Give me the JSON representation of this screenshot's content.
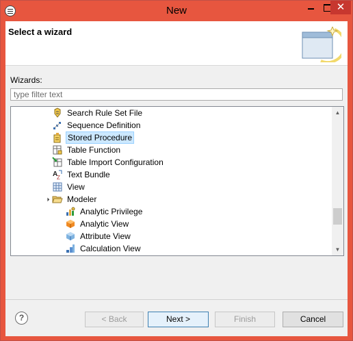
{
  "window": {
    "title": "New",
    "close_glyph": "✕"
  },
  "banner": {
    "title": "Select a wizard"
  },
  "wizards": {
    "label": "Wizards:",
    "filter_placeholder": "type filter text",
    "filter_value": "",
    "tree": [
      {
        "label": "Search Rule Set File",
        "icon": "rule-set-icon",
        "selected": false
      },
      {
        "label": "Sequence Definition",
        "icon": "sequence-icon",
        "selected": false
      },
      {
        "label": "Stored Procedure",
        "icon": "stored-procedure-icon",
        "selected": true
      },
      {
        "label": "Table Function",
        "icon": "table-function-icon",
        "selected": false
      },
      {
        "label": "Table Import Configuration",
        "icon": "table-import-icon",
        "selected": false
      },
      {
        "label": "Text Bundle",
        "icon": "text-bundle-icon",
        "selected": false
      },
      {
        "label": "View",
        "icon": "view-icon",
        "selected": false
      },
      {
        "label": "Modeler",
        "icon": "folder-open-icon",
        "selected": false,
        "expanded": true
      },
      {
        "label": "Analytic Privilege",
        "icon": "analytic-privilege-icon",
        "selected": false
      },
      {
        "label": "Analytic View",
        "icon": "analytic-view-icon",
        "selected": false
      },
      {
        "label": "Attribute View",
        "icon": "attribute-view-icon",
        "selected": false
      },
      {
        "label": "Calculation View",
        "icon": "calculation-view-icon",
        "selected": false
      }
    ]
  },
  "buttons": {
    "help": "?",
    "back": "< Back",
    "next": "Next >",
    "finish": "Finish",
    "cancel": "Cancel"
  }
}
